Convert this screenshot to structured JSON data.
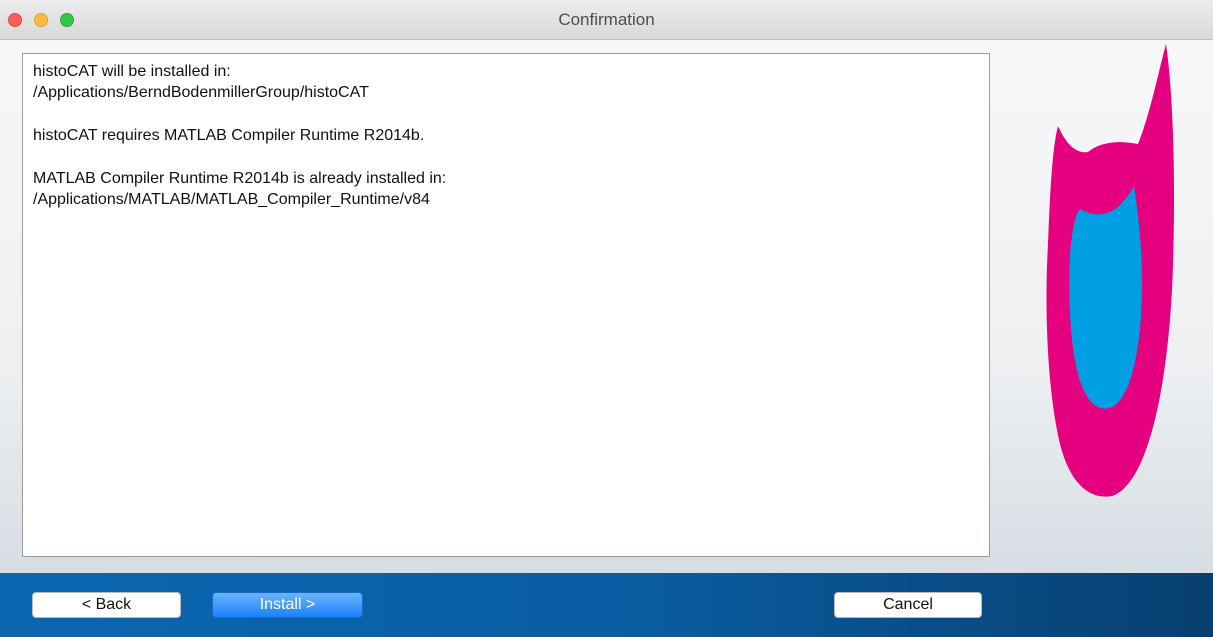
{
  "window": {
    "title": "Confirmation"
  },
  "message": {
    "paragraphs": [
      "histoCAT will be installed in:\n/Applications/BerndBodenmillerGroup/histoCAT",
      "histoCAT requires MATLAB Compiler Runtime R2014b.",
      "MATLAB Compiler Runtime R2014b is already installed in:\n/Applications/MATLAB/MATLAB_Compiler_Runtime/v84"
    ]
  },
  "buttons": {
    "back": "< Back",
    "install": "Install >",
    "cancel": "Cancel"
  },
  "colors": {
    "logo_outer": "#e4007f",
    "logo_inner": "#009fe3",
    "footer_blue": "#0a5ea3"
  }
}
